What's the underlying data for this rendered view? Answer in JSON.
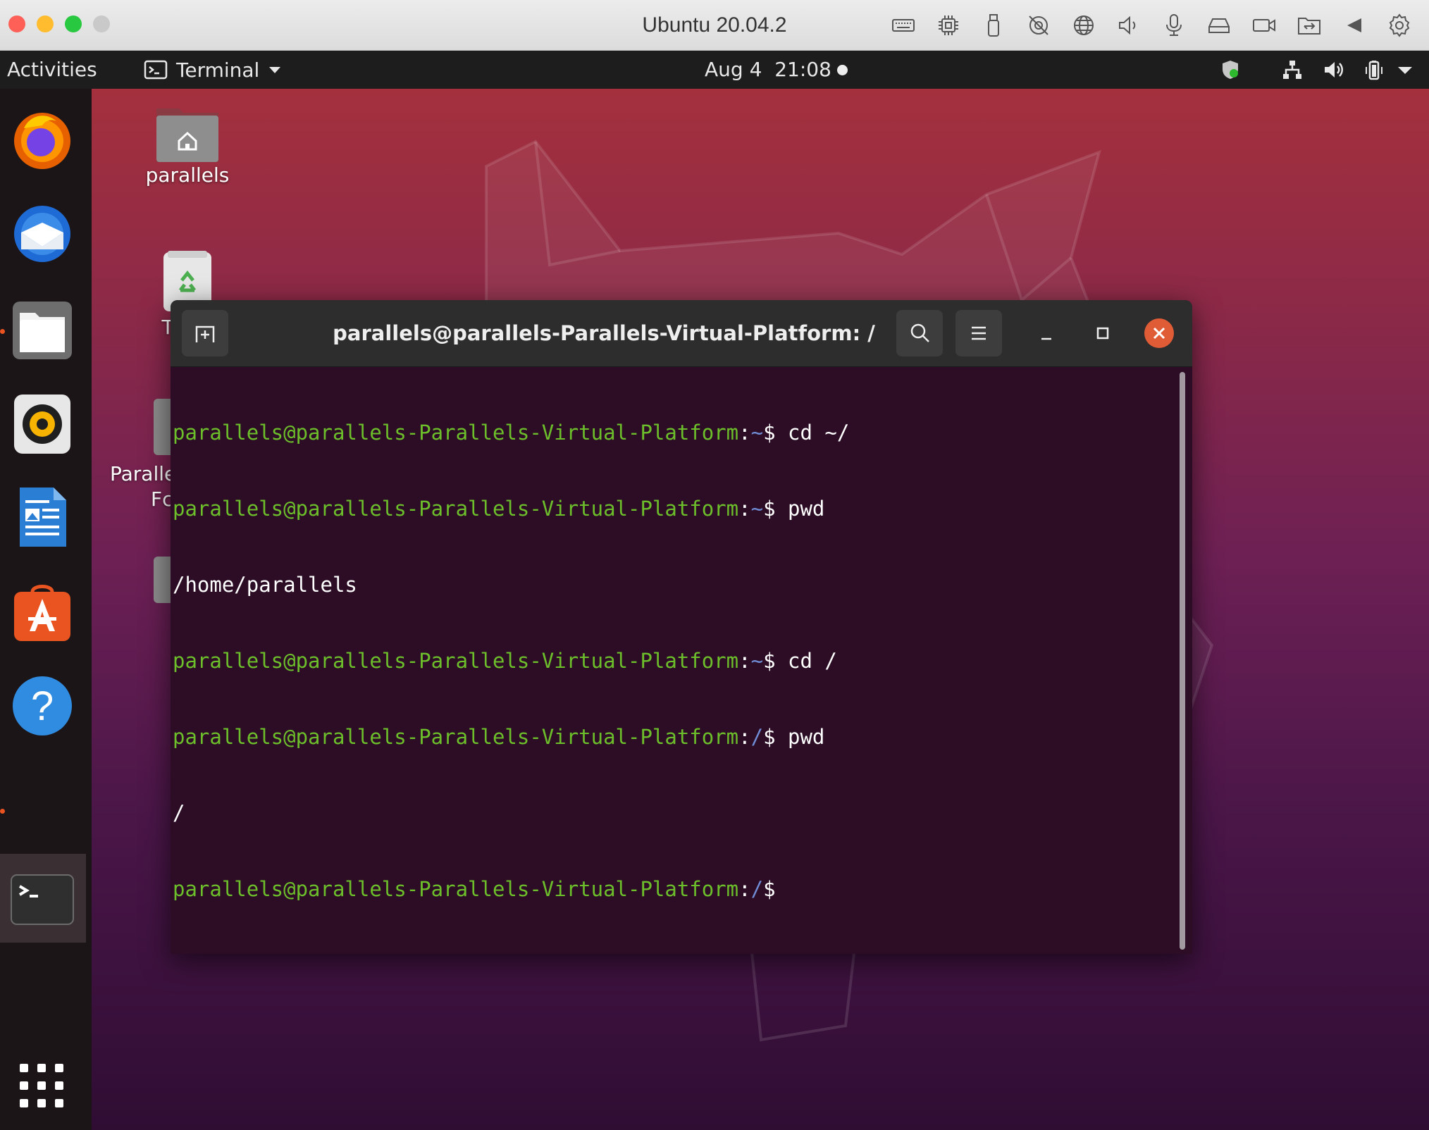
{
  "host": {
    "title": "Ubuntu 20.04.2",
    "icons": [
      "keyboard-icon",
      "cpu-icon",
      "usb-icon",
      "camera-off-icon",
      "globe-icon",
      "speaker-icon",
      "microphone-icon",
      "drive-icon",
      "video-icon",
      "shared-folder-icon",
      "back-triangle-icon",
      "settings-gear-icon"
    ]
  },
  "panel": {
    "activities": "Activities",
    "app_name": "Terminal",
    "clock_date": "Aug 4",
    "clock_time": "21:08",
    "tray": [
      "shield-update-icon",
      "network-icon",
      "volume-icon",
      "battery-icon",
      "system-menu-arrow-icon"
    ]
  },
  "dock": {
    "items": [
      "firefox",
      "thunderbird",
      "files",
      "rhythmbox",
      "libreoffice-writer",
      "ubuntu-software",
      "help",
      "terminal"
    ],
    "show_apps": "show-applications-icon"
  },
  "desktop": {
    "home_label": "parallels",
    "trash_label_visible": "T",
    "shared_label_line1": "Paralle",
    "shared_label_line2": "Fc"
  },
  "terminal": {
    "title": "parallels@parallels-Parallels-Virtual-Platform: /",
    "lines": [
      {
        "user": "parallels@parallels-Parallels-Virtual-Platform",
        "path": "~",
        "cmd": " cd ~/"
      },
      {
        "user": "parallels@parallels-Parallels-Virtual-Platform",
        "path": "~",
        "cmd": " pwd"
      },
      {
        "output": "/home/parallels"
      },
      {
        "user": "parallels@parallels-Parallels-Virtual-Platform",
        "path": "~",
        "cmd": " cd /"
      },
      {
        "user": "parallels@parallels-Parallels-Virtual-Platform",
        "path": "/",
        "cmd": " pwd"
      },
      {
        "output": "/"
      },
      {
        "user": "parallels@parallels-Parallels-Virtual-Platform",
        "path": "/",
        "cmd": ""
      }
    ]
  },
  "colors": {
    "prompt_user": "#6cbe2b",
    "prompt_path": "#6f8cd5",
    "terminal_bg": "#2c0d25",
    "close_button": "#e05c36"
  }
}
